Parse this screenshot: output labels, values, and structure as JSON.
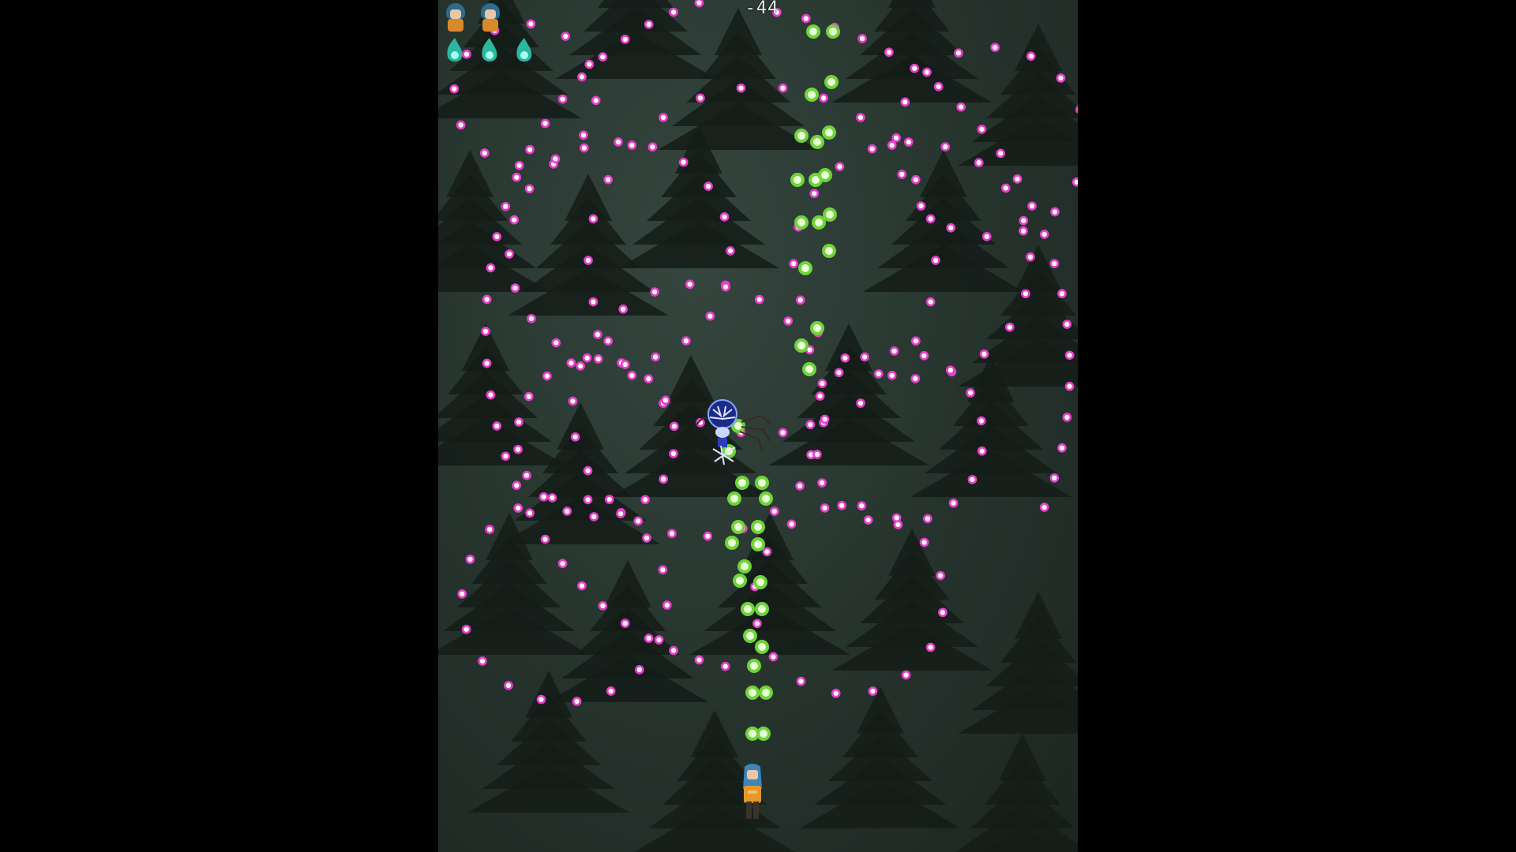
{
  "hud": {
    "timer": "-44",
    "lives": [
      {
        "icon": "player-life-icon"
      },
      {
        "icon": "player-life-icon"
      }
    ],
    "bombs": [
      {
        "icon": "spirit-bomb-icon"
      },
      {
        "icon": "spirit-bomb-icon"
      },
      {
        "icon": "spirit-bomb-icon"
      }
    ]
  },
  "entities": {
    "boss": {
      "icon": "blue-spider-boss-icon"
    },
    "player": {
      "icon": "blue-haired-girl-player-icon"
    }
  },
  "colors": {
    "background": "#000000",
    "forest_floor": "#2b3832",
    "tree": "#141c18",
    "enemy_bullet": "#e83ecb",
    "enemy_bullet_core": "#ffffff",
    "player_shot": "#6fd43a",
    "player_shot_core": "#eaffd8",
    "timer_text": "#e8e8e8"
  }
}
